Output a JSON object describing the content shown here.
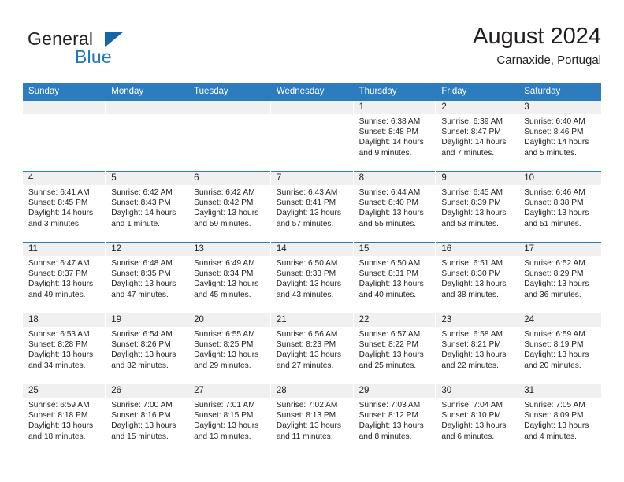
{
  "brand": {
    "name_part1": "General",
    "name_part2": "Blue",
    "triangle_icon": "triangle-icon",
    "accent_color": "#1f77bd"
  },
  "header": {
    "title": "August 2024",
    "subtitle": "Carnaxide, Portugal"
  },
  "theme": {
    "header_blue": "#2e7cc0",
    "daynum_band": "#f0f0f0",
    "text": "#231f20"
  },
  "calendar": {
    "weekday_headers": [
      "Sunday",
      "Monday",
      "Tuesday",
      "Wednesday",
      "Thursday",
      "Friday",
      "Saturday"
    ],
    "labels": {
      "sunrise": "Sunrise:",
      "sunset": "Sunset:",
      "daylight": "Daylight:"
    },
    "weeks": [
      [
        {
          "day": "",
          "sunrise": "",
          "sunset": "",
          "daylight_line1": "",
          "daylight_line2": ""
        },
        {
          "day": "",
          "sunrise": "",
          "sunset": "",
          "daylight_line1": "",
          "daylight_line2": ""
        },
        {
          "day": "",
          "sunrise": "",
          "sunset": "",
          "daylight_line1": "",
          "daylight_line2": ""
        },
        {
          "day": "",
          "sunrise": "",
          "sunset": "",
          "daylight_line1": "",
          "daylight_line2": ""
        },
        {
          "day": "1",
          "sunrise": "Sunrise: 6:38 AM",
          "sunset": "Sunset: 8:48 PM",
          "daylight_line1": "Daylight: 14 hours",
          "daylight_line2": "and 9 minutes."
        },
        {
          "day": "2",
          "sunrise": "Sunrise: 6:39 AM",
          "sunset": "Sunset: 8:47 PM",
          "daylight_line1": "Daylight: 14 hours",
          "daylight_line2": "and 7 minutes."
        },
        {
          "day": "3",
          "sunrise": "Sunrise: 6:40 AM",
          "sunset": "Sunset: 8:46 PM",
          "daylight_line1": "Daylight: 14 hours",
          "daylight_line2": "and 5 minutes."
        }
      ],
      [
        {
          "day": "4",
          "sunrise": "Sunrise: 6:41 AM",
          "sunset": "Sunset: 8:45 PM",
          "daylight_line1": "Daylight: 14 hours",
          "daylight_line2": "and 3 minutes."
        },
        {
          "day": "5",
          "sunrise": "Sunrise: 6:42 AM",
          "sunset": "Sunset: 8:43 PM",
          "daylight_line1": "Daylight: 14 hours",
          "daylight_line2": "and 1 minute."
        },
        {
          "day": "6",
          "sunrise": "Sunrise: 6:42 AM",
          "sunset": "Sunset: 8:42 PM",
          "daylight_line1": "Daylight: 13 hours",
          "daylight_line2": "and 59 minutes."
        },
        {
          "day": "7",
          "sunrise": "Sunrise: 6:43 AM",
          "sunset": "Sunset: 8:41 PM",
          "daylight_line1": "Daylight: 13 hours",
          "daylight_line2": "and 57 minutes."
        },
        {
          "day": "8",
          "sunrise": "Sunrise: 6:44 AM",
          "sunset": "Sunset: 8:40 PM",
          "daylight_line1": "Daylight: 13 hours",
          "daylight_line2": "and 55 minutes."
        },
        {
          "day": "9",
          "sunrise": "Sunrise: 6:45 AM",
          "sunset": "Sunset: 8:39 PM",
          "daylight_line1": "Daylight: 13 hours",
          "daylight_line2": "and 53 minutes."
        },
        {
          "day": "10",
          "sunrise": "Sunrise: 6:46 AM",
          "sunset": "Sunset: 8:38 PM",
          "daylight_line1": "Daylight: 13 hours",
          "daylight_line2": "and 51 minutes."
        }
      ],
      [
        {
          "day": "11",
          "sunrise": "Sunrise: 6:47 AM",
          "sunset": "Sunset: 8:37 PM",
          "daylight_line1": "Daylight: 13 hours",
          "daylight_line2": "and 49 minutes."
        },
        {
          "day": "12",
          "sunrise": "Sunrise: 6:48 AM",
          "sunset": "Sunset: 8:35 PM",
          "daylight_line1": "Daylight: 13 hours",
          "daylight_line2": "and 47 minutes."
        },
        {
          "day": "13",
          "sunrise": "Sunrise: 6:49 AM",
          "sunset": "Sunset: 8:34 PM",
          "daylight_line1": "Daylight: 13 hours",
          "daylight_line2": "and 45 minutes."
        },
        {
          "day": "14",
          "sunrise": "Sunrise: 6:50 AM",
          "sunset": "Sunset: 8:33 PM",
          "daylight_line1": "Daylight: 13 hours",
          "daylight_line2": "and 43 minutes."
        },
        {
          "day": "15",
          "sunrise": "Sunrise: 6:50 AM",
          "sunset": "Sunset: 8:31 PM",
          "daylight_line1": "Daylight: 13 hours",
          "daylight_line2": "and 40 minutes."
        },
        {
          "day": "16",
          "sunrise": "Sunrise: 6:51 AM",
          "sunset": "Sunset: 8:30 PM",
          "daylight_line1": "Daylight: 13 hours",
          "daylight_line2": "and 38 minutes."
        },
        {
          "day": "17",
          "sunrise": "Sunrise: 6:52 AM",
          "sunset": "Sunset: 8:29 PM",
          "daylight_line1": "Daylight: 13 hours",
          "daylight_line2": "and 36 minutes."
        }
      ],
      [
        {
          "day": "18",
          "sunrise": "Sunrise: 6:53 AM",
          "sunset": "Sunset: 8:28 PM",
          "daylight_line1": "Daylight: 13 hours",
          "daylight_line2": "and 34 minutes."
        },
        {
          "day": "19",
          "sunrise": "Sunrise: 6:54 AM",
          "sunset": "Sunset: 8:26 PM",
          "daylight_line1": "Daylight: 13 hours",
          "daylight_line2": "and 32 minutes."
        },
        {
          "day": "20",
          "sunrise": "Sunrise: 6:55 AM",
          "sunset": "Sunset: 8:25 PM",
          "daylight_line1": "Daylight: 13 hours",
          "daylight_line2": "and 29 minutes."
        },
        {
          "day": "21",
          "sunrise": "Sunrise: 6:56 AM",
          "sunset": "Sunset: 8:23 PM",
          "daylight_line1": "Daylight: 13 hours",
          "daylight_line2": "and 27 minutes."
        },
        {
          "day": "22",
          "sunrise": "Sunrise: 6:57 AM",
          "sunset": "Sunset: 8:22 PM",
          "daylight_line1": "Daylight: 13 hours",
          "daylight_line2": "and 25 minutes."
        },
        {
          "day": "23",
          "sunrise": "Sunrise: 6:58 AM",
          "sunset": "Sunset: 8:21 PM",
          "daylight_line1": "Daylight: 13 hours",
          "daylight_line2": "and 22 minutes."
        },
        {
          "day": "24",
          "sunrise": "Sunrise: 6:59 AM",
          "sunset": "Sunset: 8:19 PM",
          "daylight_line1": "Daylight: 13 hours",
          "daylight_line2": "and 20 minutes."
        }
      ],
      [
        {
          "day": "25",
          "sunrise": "Sunrise: 6:59 AM",
          "sunset": "Sunset: 8:18 PM",
          "daylight_line1": "Daylight: 13 hours",
          "daylight_line2": "and 18 minutes."
        },
        {
          "day": "26",
          "sunrise": "Sunrise: 7:00 AM",
          "sunset": "Sunset: 8:16 PM",
          "daylight_line1": "Daylight: 13 hours",
          "daylight_line2": "and 15 minutes."
        },
        {
          "day": "27",
          "sunrise": "Sunrise: 7:01 AM",
          "sunset": "Sunset: 8:15 PM",
          "daylight_line1": "Daylight: 13 hours",
          "daylight_line2": "and 13 minutes."
        },
        {
          "day": "28",
          "sunrise": "Sunrise: 7:02 AM",
          "sunset": "Sunset: 8:13 PM",
          "daylight_line1": "Daylight: 13 hours",
          "daylight_line2": "and 11 minutes."
        },
        {
          "day": "29",
          "sunrise": "Sunrise: 7:03 AM",
          "sunset": "Sunset: 8:12 PM",
          "daylight_line1": "Daylight: 13 hours",
          "daylight_line2": "and 8 minutes."
        },
        {
          "day": "30",
          "sunrise": "Sunrise: 7:04 AM",
          "sunset": "Sunset: 8:10 PM",
          "daylight_line1": "Daylight: 13 hours",
          "daylight_line2": "and 6 minutes."
        },
        {
          "day": "31",
          "sunrise": "Sunrise: 7:05 AM",
          "sunset": "Sunset: 8:09 PM",
          "daylight_line1": "Daylight: 13 hours",
          "daylight_line2": "and 4 minutes."
        }
      ]
    ]
  }
}
